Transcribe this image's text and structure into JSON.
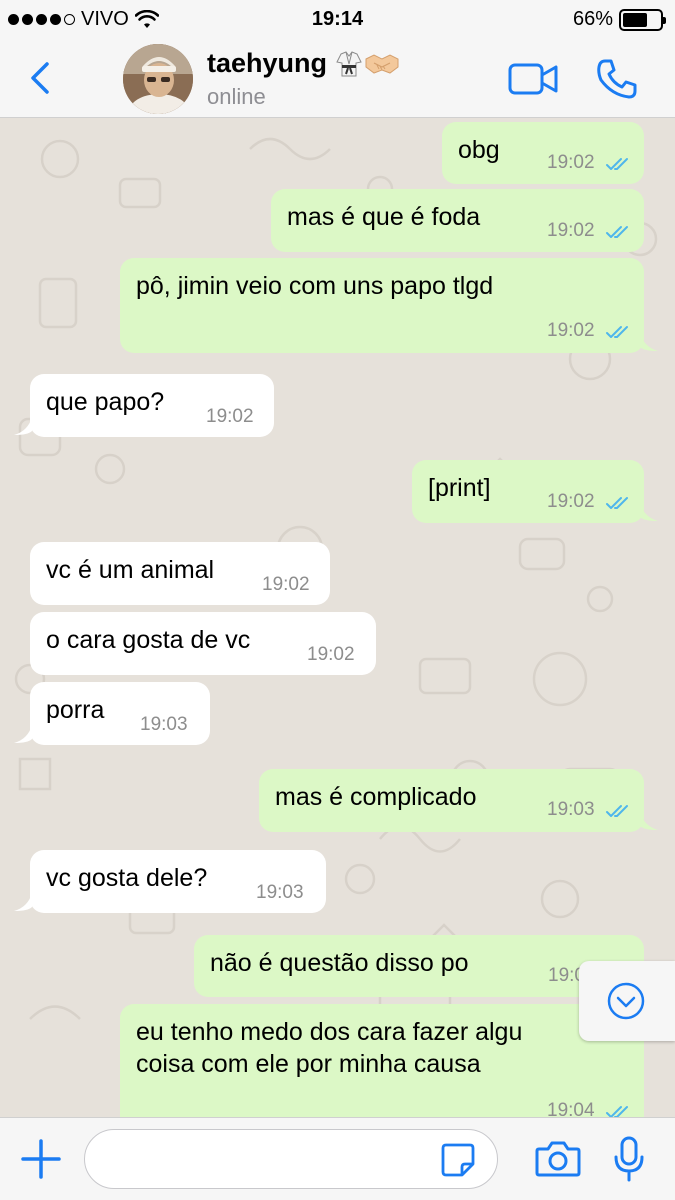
{
  "status_bar": {
    "carrier": "VIVO",
    "time": "19:14",
    "battery_percent": "66%",
    "battery_level": 0.66,
    "signal_bars": 4,
    "signal_total": 5
  },
  "header": {
    "contact_name": "taehyung",
    "name_emojis": [
      "martial-arts-uniform-emoji",
      "handshake-emoji"
    ],
    "status": "online",
    "accent_color": "#1b7cf2"
  },
  "messages": [
    {
      "dir": "out",
      "text": "obg",
      "time": "19:02",
      "read": true
    },
    {
      "dir": "out",
      "text": "mas é que é foda",
      "time": "19:02",
      "read": true
    },
    {
      "dir": "out",
      "text": "pô, jimin veio com uns papo tlgd",
      "time": "19:02",
      "read": true
    },
    {
      "dir": "in",
      "text": "que papo?",
      "time": "19:02"
    },
    {
      "dir": "out",
      "text": "[print]",
      "time": "19:02",
      "read": true
    },
    {
      "dir": "in",
      "text": "vc é um animal",
      "time": "19:02"
    },
    {
      "dir": "in",
      "text": "o cara gosta de vc",
      "time": "19:02"
    },
    {
      "dir": "in",
      "text": "porra",
      "time": "19:03"
    },
    {
      "dir": "out",
      "text": "mas é complicado",
      "time": "19:03",
      "read": true
    },
    {
      "dir": "in",
      "text": "vc gosta dele?",
      "time": "19:03"
    },
    {
      "dir": "out",
      "text": "não é questão disso po",
      "time": "19:0"
    },
    {
      "dir": "out",
      "text_lines": [
        "eu tenho medo dos cara fazer algu",
        "coisa com ele por minha causa"
      ],
      "time": "19:04",
      "read": true
    }
  ],
  "input": {
    "placeholder": "",
    "value": ""
  },
  "colors": {
    "outgoing_bubble": "#dcf8c6",
    "incoming_bubble": "#ffffff",
    "chat_background": "#e6e1da",
    "read_ticks": "#4fb6ec"
  }
}
